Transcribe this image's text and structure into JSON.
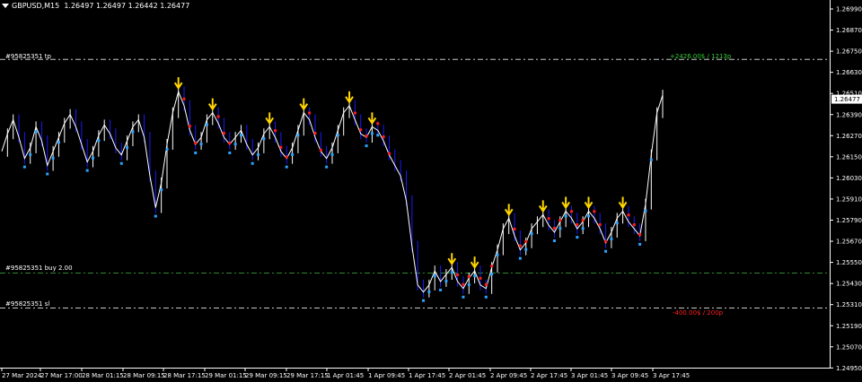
{
  "header": {
    "symbol_tf": "GBPUSD,M15",
    "ohlc": "1.26497 1.26497 1.26442 1.26477"
  },
  "colors": {
    "background": "#000000",
    "axis": "#ffffff",
    "price_line": "#ffffff",
    "down_wick": "#1a1aff",
    "arrow_yellow": "#ffd400",
    "dot_red": "#ff1a1a",
    "dot_blue": "#2aa3ff",
    "level_line": "#c8c8c8",
    "buy_line": "#2e8b2e",
    "tp_text": "#33cc33",
    "sl_text": "#ff2020"
  },
  "y_axis": {
    "ticks": [
      "1.26990",
      "1.26870",
      "1.26750",
      "1.26630",
      "1.26510",
      "1.26390",
      "1.26270",
      "1.26150",
      "1.26030",
      "1.25910",
      "1.25790",
      "1.25670",
      "1.25550",
      "1.25430",
      "1.25310",
      "1.25190",
      "1.25070",
      "1.24950"
    ],
    "current_price": "1.26477"
  },
  "x_axis": {
    "ticks": [
      "27 Mar 2024",
      "27 Mar 17:00",
      "28 Mar 01:15",
      "28 Mar 09:15",
      "28 Mar 17:15",
      "29 Mar 01:15",
      "29 Mar 09:15",
      "29 Mar 17:15",
      "1 Apr 01:45",
      "1 Apr 09:45",
      "1 Apr 17:45",
      "2 Apr 01:45",
      "2 Apr 09:45",
      "2 Apr 17:45",
      "3 Apr 01:45",
      "3 Apr 09:45",
      "3 Apr 17:45"
    ]
  },
  "levels": {
    "tp": {
      "label": "#95825351 tp",
      "price": 1.26703,
      "result": "+2426.00$ / 1213p"
    },
    "buy": {
      "label": "#95825351 buy 2.00",
      "price": 1.25488
    },
    "sl": {
      "label": "#95825351 sl",
      "price": 1.25289,
      "result": "-400.00$ / 200p"
    }
  },
  "chart_data": {
    "type": "line",
    "ylim": [
      1.2495,
      1.2699
    ],
    "series": [
      {
        "values": [
          1.2618,
          1.2628,
          1.2636,
          1.2626,
          1.2614,
          1.262,
          1.2632,
          1.2624,
          1.261,
          1.2618,
          1.2626,
          1.2634,
          1.2639,
          1.2632,
          1.2622,
          1.2612,
          1.2618,
          1.2627,
          1.2633,
          1.2628,
          1.262,
          1.2616,
          1.2624,
          1.2632,
          1.2636,
          1.2626,
          1.2604,
          1.2586,
          1.26,
          1.2622,
          1.264,
          1.2652,
          1.2644,
          1.263,
          1.2622,
          1.2626,
          1.2636,
          1.264,
          1.2634,
          1.2626,
          1.2622,
          1.2626,
          1.263,
          1.2622,
          1.2616,
          1.262,
          1.2628,
          1.2632,
          1.2626,
          1.2618,
          1.2614,
          1.262,
          1.263,
          1.264,
          1.2636,
          1.2626,
          1.2618,
          1.2614,
          1.262,
          1.263,
          1.264,
          1.2644,
          1.2636,
          1.2628,
          1.2626,
          1.2632,
          1.263,
          1.2624,
          1.2616,
          1.261,
          1.2604,
          1.259,
          1.2564,
          1.2542,
          1.2538,
          1.2542,
          1.255,
          1.2544,
          1.2548,
          1.2552,
          1.2544,
          1.254,
          1.2546,
          1.255,
          1.2542,
          1.254,
          1.2552,
          1.2562,
          1.2574,
          1.258,
          1.257,
          1.2562,
          1.2566,
          1.2574,
          1.2578,
          1.2582,
          1.2576,
          1.2572,
          1.2578,
          1.2584,
          1.258,
          1.2574,
          1.2578,
          1.2584,
          1.258,
          1.2574,
          1.2566,
          1.2572,
          1.258,
          1.2584,
          1.2578,
          1.2574,
          1.257,
          1.2588,
          1.2616,
          1.264,
          1.265
        ]
      }
    ]
  }
}
